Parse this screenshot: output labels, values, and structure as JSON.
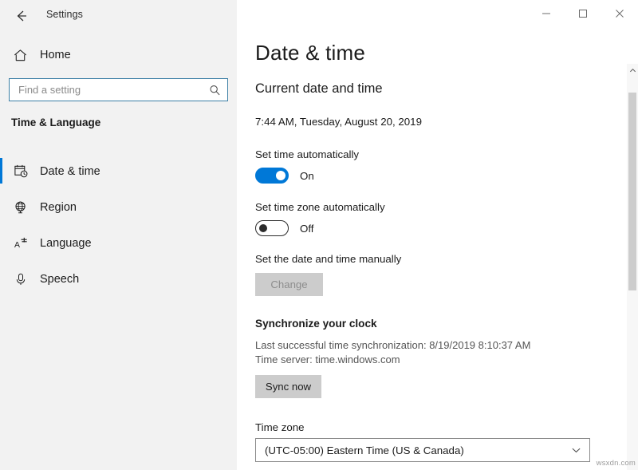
{
  "window": {
    "app_title": "Settings",
    "back_icon": "back-arrow-icon",
    "controls": {
      "minimize": "minimize-icon",
      "maximize": "maximize-icon",
      "close": "close-icon"
    }
  },
  "sidebar": {
    "home_label": "Home",
    "home_icon": "home-icon",
    "search": {
      "placeholder": "Find a setting",
      "value": "",
      "icon": "search-icon"
    },
    "group_title": "Time & Language",
    "items": [
      {
        "label": "Date & time",
        "icon": "calendar-clock-icon",
        "selected": true
      },
      {
        "label": "Region",
        "icon": "globe-icon",
        "selected": false
      },
      {
        "label": "Language",
        "icon": "language-a-icon",
        "selected": false
      },
      {
        "label": "Speech",
        "icon": "microphone-icon",
        "selected": false
      }
    ]
  },
  "main": {
    "page_title": "Date & time",
    "current_section": {
      "heading": "Current date and time",
      "value": "7:44 AM, Tuesday, August 20, 2019"
    },
    "set_time_auto": {
      "label": "Set time automatically",
      "state": "On",
      "on": true
    },
    "set_timezone_auto": {
      "label": "Set time zone automatically",
      "state": "Off",
      "on": false
    },
    "manual": {
      "label": "Set the date and time manually",
      "button_label": "Change",
      "button_disabled": true
    },
    "synchronize": {
      "heading": "Synchronize your clock",
      "last_sync": "Last successful time synchronization: 8/19/2019 8:10:37 AM",
      "time_server": "Time server: time.windows.com",
      "button_label": "Sync now"
    },
    "time_zone": {
      "label": "Time zone",
      "selected": "(UTC-05:00) Eastern Time (US & Canada)",
      "chevron_icon": "chevron-down-icon"
    },
    "scrollbar": {
      "up_icon": "chevron-up-icon"
    }
  },
  "watermark": "wsxdn.com",
  "colors": {
    "accent": "#0078d7",
    "sidebar_bg": "#f2f2f2",
    "button_bg": "#cccccc",
    "search_border": "#3c7fa5"
  }
}
